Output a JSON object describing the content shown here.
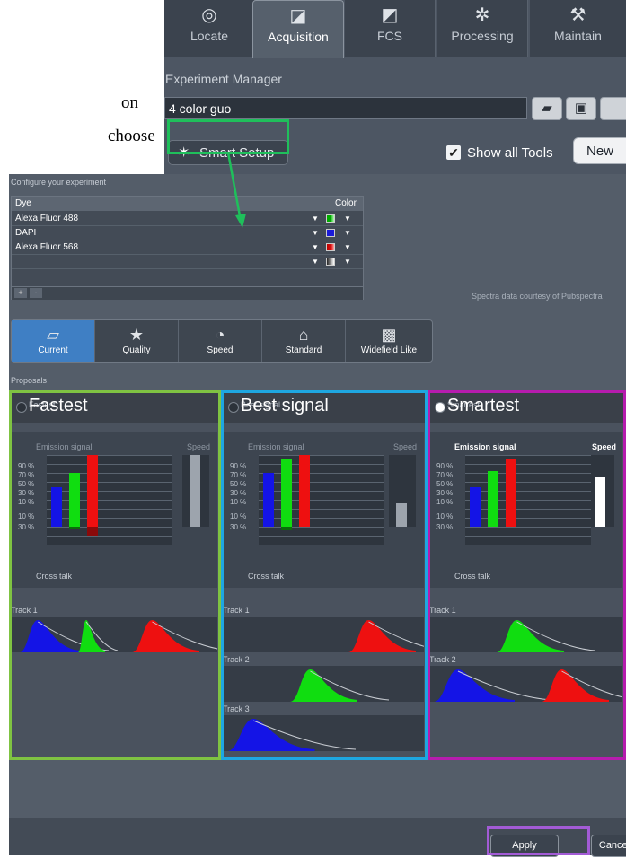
{
  "doc": {
    "line1": "on",
    "line2": "choose   the"
  },
  "tabs": [
    {
      "label": "Locate",
      "icon": "locate-icon"
    },
    {
      "label": "Acquisition",
      "icon": "acquisition-icon"
    },
    {
      "label": "FCS",
      "icon": "fcs-icon"
    },
    {
      "label": "Processing",
      "icon": "processing-icon"
    },
    {
      "label": "Maintain",
      "icon": "maintain-icon"
    }
  ],
  "experiment": {
    "title": "Experiment Manager",
    "name": "4 color guo",
    "smart_setup": "Smart Setup",
    "show_all_tools": "Show all Tools",
    "new_label": "New"
  },
  "configure": {
    "title": "Configure your experiment",
    "col_dye": "Dye",
    "col_color": "Color",
    "rows": [
      {
        "dye": "Alexa Fluor 488",
        "color": "#22c122"
      },
      {
        "dye": "DAPI",
        "color": "#1a1ad8"
      },
      {
        "dye": "Alexa Fluor 568",
        "color": "#d81a1a"
      },
      {
        "dye": "",
        "color": "#dddddd"
      }
    ],
    "add": "+",
    "remove": "-",
    "credit": "Spectra data courtesy of Pubspectra"
  },
  "modes": [
    {
      "label": "Current",
      "icon": "current-icon",
      "active": true
    },
    {
      "label": "Quality",
      "icon": "star-icon"
    },
    {
      "label": "Speed",
      "icon": "speedometer-icon"
    },
    {
      "label": "Standard",
      "icon": "home-icon"
    },
    {
      "label": "Widefield Like",
      "icon": "widefield-icon"
    }
  ],
  "proposals": {
    "title": "Proposals",
    "emission_signal": "Emission signal",
    "speed": "Speed",
    "cross_talk": "Cross talk",
    "yticks_top": [
      "90 %",
      "70 %",
      "50 %",
      "30 %",
      "10 %"
    ],
    "yticks_bottom": [
      "10 %",
      "30 %"
    ],
    "panels": [
      {
        "label": "Fastest",
        "radio_text": "Fastest",
        "border": "#7fc342",
        "emission": [
          55,
          75,
          100
        ],
        "crosstalk": [
          0,
          3,
          12
        ],
        "speed": 100,
        "tracks": [
          "Track 1"
        ]
      },
      {
        "label": "Best signal",
        "radio_text": "Best signal",
        "border": "#1ea7e1",
        "emission": [
          75,
          95,
          100
        ],
        "crosstalk": [
          0,
          5,
          0
        ],
        "speed": 33,
        "tracks": [
          "Track 1",
          "Track 2",
          "Track 3"
        ]
      },
      {
        "label": "Smartest",
        "radio_text": "Smartest",
        "border": "#b61cae",
        "emission": [
          55,
          78,
          95
        ],
        "crosstalk": [
          0,
          0,
          0
        ],
        "speed": 70,
        "tracks": [
          "Track 1",
          "Track 2"
        ]
      }
    ]
  },
  "apply": "Apply",
  "cancel": "Cancel",
  "colors": {
    "panel": "#545d69",
    "highlight_green": "#1fbf5b",
    "highlight_purple": "#a35bd6"
  }
}
